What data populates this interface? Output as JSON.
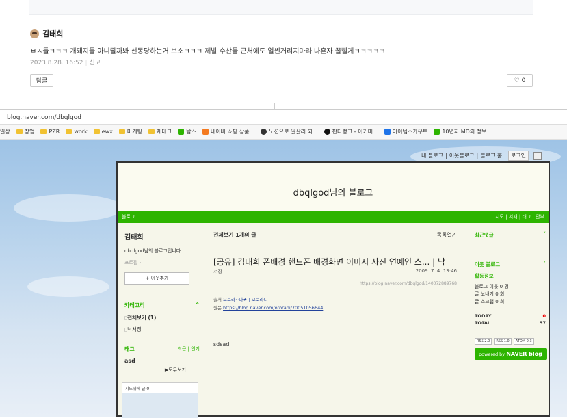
{
  "comment": {
    "author": "김태희",
    "text": "ㅂㅅ들ㅋㅋㅋ 개돼지들 아니랄까봐 선동당하는거 보소ㅋㅋㅋ 제발 수산물 근처에도 얼씬거리지마라 나혼자 꿀빨게ㅋㅋㅋㅋㅋ",
    "date": "2023.8.28. 16:52",
    "report": "신고",
    "reply_label": "답글",
    "like_icon": "heart-icon",
    "like_count": "0"
  },
  "browser": {
    "url": "blog.naver.com/dbqlgod",
    "bookmarks": [
      "일상",
      "창업",
      "PZR",
      "work",
      "ewx",
      "마케팅",
      "재테크",
      "탐스",
      "네이버 쇼핑 상품...",
      "노션으로 일잘러 되...",
      "판다랭크 - 이커머...",
      "아이템스카우트",
      "10년차 MD의 정보..."
    ]
  },
  "gnb": {
    "my_blog": "내 블로그",
    "neighbor_blog": "이웃블로그",
    "blog_home": "블로그 홈",
    "login": "로그인"
  },
  "blog": {
    "title": "dbqlgod님의 블로그",
    "menu_left": "블로그",
    "menu_right": "지도 | 서재 | 태그 | 안부",
    "nickname": "김태희",
    "description": "dbqlgod님의 블로그입니다.",
    "profile": "프로필 ›",
    "add_neighbor": "+ 이웃추가",
    "category_title": "카테고리",
    "category_toggle": "^",
    "categories": [
      "전체보기 (1)",
      "낙서장"
    ],
    "tag_title": "태그",
    "tag_options": "최근 | 인기",
    "tag": "asd",
    "all_tags": "▶모두보기",
    "map_title": "지도위에 글 0",
    "list_header": "전체보기 1개의 글",
    "list_toggle": "목록열기",
    "post_title": "[공유] 김태희 폰배경 핸드폰 배경화면 이미지 사진 연예인 스... | 낙",
    "post_category": "서장",
    "post_date": "2009. 7. 4. 13:46",
    "post_url": "https://blog.naver.com/dbqlgod/140072889768",
    "source_label": "출처",
    "source_link": "오로라~나★ | 오로라니",
    "original_label": "원문",
    "original_link": "https://blog.naver.com/ororani/70051056644",
    "body": "sdsad",
    "recent_comments": "최근댓글",
    "neighbor_blog_title": "이웃 블로그",
    "activity_title": "활동정보",
    "activity": [
      "블로그 이웃 0 명",
      "글 보내기 0 회",
      "글 스크랩 0 회"
    ],
    "today_label": "TODAY",
    "today_value": "0",
    "total_label": "TOTAL",
    "total_value": "57",
    "rss": [
      "RSS 2.0",
      "RSS 1.0",
      "ATOM 0.3"
    ],
    "powered": "powered by",
    "powered_brand": "NAVER blog"
  }
}
